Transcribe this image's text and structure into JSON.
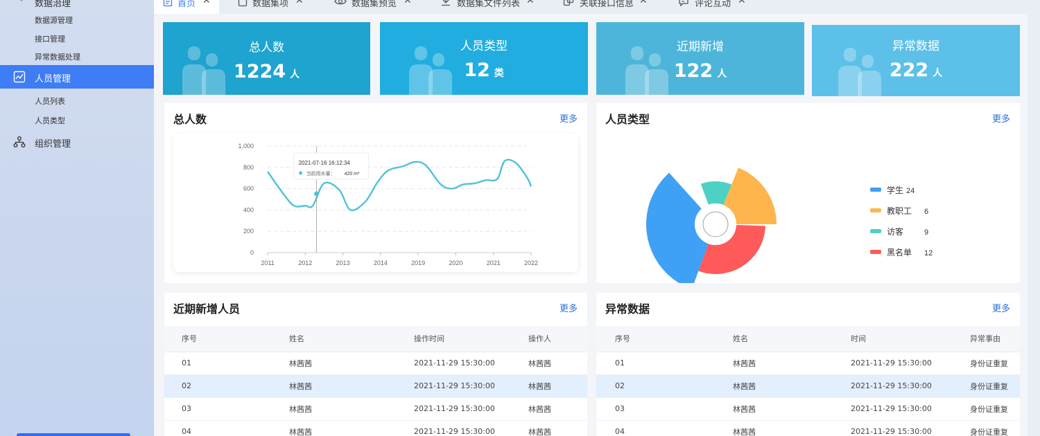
{
  "sidebar": {
    "top_item": "数据治理",
    "top_subitems": [
      "数据源管理",
      "接口管理",
      "异常数据处理"
    ],
    "people": {
      "label": "人员管理",
      "subitems": [
        "人员列表",
        "人员类型"
      ]
    },
    "org": {
      "label": "组织管理"
    }
  },
  "tabs": [
    {
      "label": "首页",
      "icon": "document-icon"
    },
    {
      "label": "数据集项",
      "icon": "square-icon"
    },
    {
      "label": "数据集预览",
      "icon": "eye-icon"
    },
    {
      "label": "数据集文件列表",
      "icon": "download-icon"
    },
    {
      "label": "关联接口信息",
      "icon": "link-icon"
    },
    {
      "label": "评论互动",
      "icon": "comment-icon"
    }
  ],
  "tab_close": "✕",
  "stats": [
    {
      "title": "总人数",
      "value": "1224",
      "unit": "人"
    },
    {
      "title": "人员类型",
      "value": "12",
      "unit": "类"
    },
    {
      "title": "近期新增",
      "value": "122",
      "unit": "人"
    },
    {
      "title": "异常数据",
      "value": "222",
      "unit": "人"
    }
  ],
  "more": "更多",
  "line_panel": {
    "title": "总人数"
  },
  "pie_panel": {
    "title": "人员类型"
  },
  "new_panel": {
    "title": "近期新增人员",
    "headers": [
      "序号",
      "姓名",
      "操作时间",
      "操作人"
    ],
    "rows": [
      [
        "01",
        "林茜茜",
        "2021-11-29 15:30:00",
        "林茜茜"
      ],
      [
        "02",
        "林茜茜",
        "2021-11-29 15:30:00",
        "林茜茜"
      ],
      [
        "03",
        "林茜茜",
        "2021-11-29 15:30:00",
        "林茜茜"
      ],
      [
        "04",
        "林茜茜",
        "2021-11-29 15:30:00",
        "林茜茜"
      ]
    ]
  },
  "abnormal_panel": {
    "title": "异常数据",
    "headers": [
      "序号",
      "姓名",
      "时间",
      "异常事由"
    ],
    "rows": [
      [
        "01",
        "林茜茜",
        "2021-11-29 15:30:00",
        "身份证重复"
      ],
      [
        "02",
        "林茜茜",
        "2021-11-29 15:30:00",
        "身份证重复"
      ],
      [
        "03",
        "林茜茜",
        "2021-11-29 15:30:00",
        "身份证重复"
      ],
      [
        "04",
        "林茜茜",
        "2021-11-29 15:30:00",
        "身份证重复"
      ]
    ]
  },
  "colors": {
    "accent": "#3e7df5",
    "stat1": "#1fa3cf",
    "stat2": "#22ade0",
    "stat3": "#4db5d9",
    "stat4": "#5cc0e8",
    "line": "#4ec3d6"
  },
  "chart_data": [
    {
      "type": "line",
      "x_ticks": [
        "2011",
        "2012",
        "2013",
        "2014",
        "2019",
        "2020",
        "2021",
        "2022"
      ],
      "y_ticks": [
        "0",
        "200",
        "400",
        "600",
        "800",
        "1,000"
      ],
      "ylim": [
        0,
        1000
      ],
      "x": [
        0,
        0.4,
        0.7,
        1.0,
        1.2,
        1.5,
        1.9,
        2.2,
        2.6,
        2.9,
        3.2,
        3.6,
        3.9,
        4.2,
        4.6,
        4.9,
        5.2,
        5.5,
        5.8,
        6.1,
        6.3,
        6.6,
        6.9,
        7.0
      ],
      "values": [
        760,
        560,
        440,
        440,
        440,
        650,
        590,
        400,
        480,
        650,
        770,
        810,
        850,
        820,
        640,
        600,
        640,
        650,
        680,
        690,
        860,
        840,
        700,
        620
      ],
      "tooltip": {
        "title": "2021-07-16 16:12:34",
        "label": "当前用水量：",
        "value": "420 m³",
        "x": 1.3,
        "y": 630
      },
      "grid": true
    },
    {
      "type": "pie",
      "variant": "rose",
      "series": [
        {
          "name": "学生",
          "value": 24,
          "color": "#3fa1f5"
        },
        {
          "name": "教职工",
          "value": 6,
          "color": "#ffb54d"
        },
        {
          "name": "访客",
          "value": 9,
          "color": "#4ed1c5"
        },
        {
          "name": "黑名单",
          "value": 12,
          "color": "#ff5a5a"
        }
      ],
      "legend": "right"
    }
  ]
}
